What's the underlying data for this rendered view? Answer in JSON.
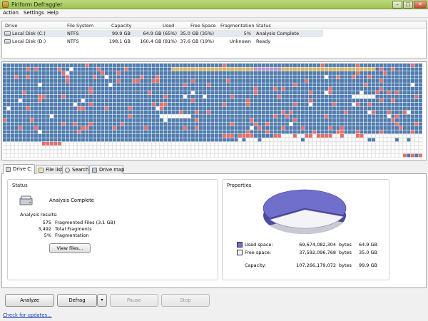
{
  "window": {
    "title": "Piriform Defraggler"
  },
  "menu": [
    "Action",
    "Settings",
    "Help"
  ],
  "drive_list": {
    "columns": [
      "Drive",
      "File System",
      "Capacity",
      "Used",
      "Free Space",
      "Fragmentation",
      "Status"
    ],
    "rows": [
      {
        "drive": "Local Disk (C:)",
        "fs": "NTFS",
        "capacity": "99.9 GB",
        "used": "64.9 GB (65%)",
        "free": "35.0 GB (35%)",
        "frag": "5%",
        "status": "Analysis Complete",
        "selected": true
      },
      {
        "drive": "Local Disk (D:)",
        "fs": "NTFS",
        "capacity": "198.1 GB",
        "used": "160.4 GB (81%)",
        "free": "37.6 GB (19%)",
        "frag": "Unknown",
        "status": "Ready",
        "selected": false
      }
    ]
  },
  "colors": {
    "used": "#4f7bad",
    "fragmented": "#e0706c",
    "free": "#ffffff",
    "system": "#d7b464",
    "mft": "#b894c6",
    "pie_used": "#7070cc",
    "pie_free": "#f4f4f8"
  },
  "tabs": [
    "Drive C:",
    "File list",
    "Search",
    "Drive map"
  ],
  "status": {
    "title": "Status",
    "text": "Analysis Complete",
    "results_title": "Analysis results:",
    "results": [
      {
        "value": "575",
        "label": "Fragmented Files (3.1 GB)"
      },
      {
        "value": "3,492",
        "label": "Total Fragments"
      },
      {
        "value": "5%",
        "label": "Fragmentation"
      }
    ],
    "view_files": "View files..."
  },
  "properties": {
    "title": "Properties",
    "used_fraction": 0.65,
    "rows": [
      {
        "label": "Used space:",
        "bytes": "69,674,082,304",
        "unit": "bytes",
        "size": "64.9 GB"
      },
      {
        "label": "Free space:",
        "bytes": "37,592,096,768",
        "unit": "bytes",
        "size": "35.0 GB"
      },
      {
        "label": "Capacity:",
        "bytes": "107,266,179,072",
        "unit": "bytes",
        "size": "99.9 GB"
      }
    ]
  },
  "buttons": {
    "analyze": "Analyze",
    "defrag": "Defrag",
    "pause": "Pause",
    "stop": "Stop"
  },
  "footer_link": "Check for updates..."
}
